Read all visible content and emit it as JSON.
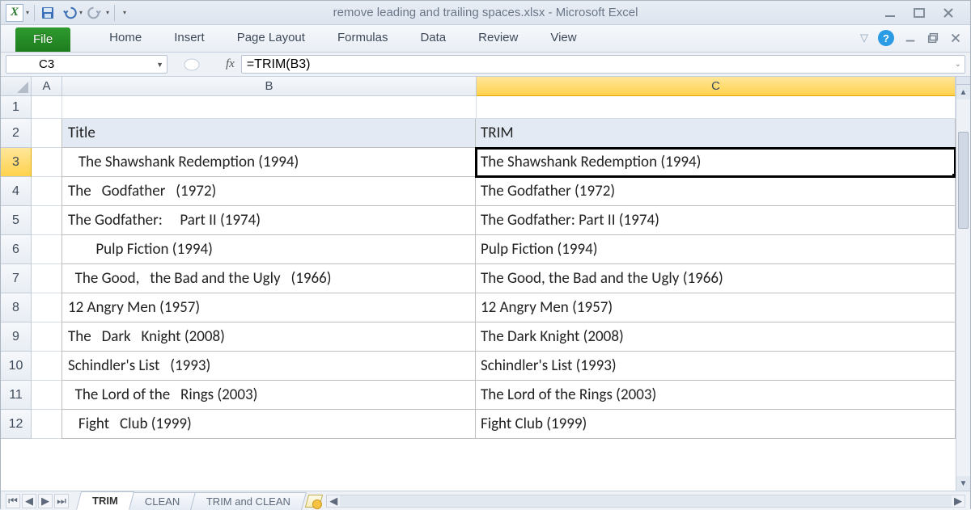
{
  "app": {
    "title": "remove leading and trailing spaces.xlsx  -  Microsoft Excel"
  },
  "ribbon": {
    "file_label": "File",
    "tabs": [
      "Home",
      "Insert",
      "Page Layout",
      "Formulas",
      "Data",
      "Review",
      "View"
    ]
  },
  "formula_bar": {
    "namebox": "C3",
    "fx_label": "fx",
    "formula": "=TRIM(B3)"
  },
  "columns": [
    "A",
    "B",
    "C"
  ],
  "row_numbers": [
    "1",
    "2",
    "3",
    "4",
    "5",
    "6",
    "7",
    "8",
    "9",
    "10",
    "11",
    "12"
  ],
  "header_row": {
    "B": "Title",
    "C": "TRIM"
  },
  "data_rows": [
    {
      "B": "   The Shawshank Redemption (1994)",
      "C": "The Shawshank Redemption (1994)"
    },
    {
      "B": "The   Godfather   (1972)",
      "C": "The Godfather (1972)"
    },
    {
      "B": "The Godfather:     Part II (1974)",
      "C": "The Godfather: Part II (1974)"
    },
    {
      "B": "        Pulp Fiction (1994)",
      "C": "Pulp Fiction (1994)"
    },
    {
      "B": "  The Good,   the Bad and the Ugly   (1966)",
      "C": "The Good, the Bad and the Ugly (1966)"
    },
    {
      "B": "12 Angry Men (1957)",
      "C": "12 Angry Men (1957)"
    },
    {
      "B": "The   Dark   Knight (2008)",
      "C": "The Dark Knight (2008)"
    },
    {
      "B": "Schindler's List   (1993)",
      "C": "Schindler's List (1993)"
    },
    {
      "B": "  The Lord of the   Rings (2003)",
      "C": "The Lord of the Rings (2003)"
    },
    {
      "B": "   Fight   Club (1999)",
      "C": "Fight Club (1999)"
    }
  ],
  "sheets": {
    "active": "TRIM",
    "tabs": [
      "TRIM",
      "CLEAN",
      "TRIM and CLEAN"
    ]
  },
  "active_cell": "C3"
}
